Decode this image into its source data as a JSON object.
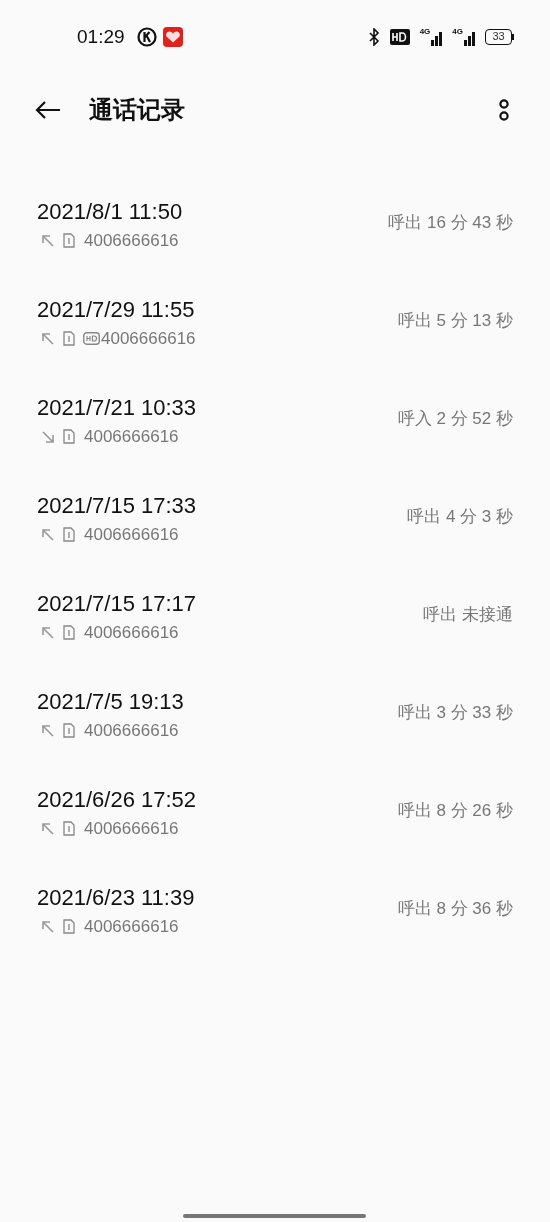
{
  "status_bar": {
    "time": "01:29",
    "network_1": "4G",
    "network_2": "4G",
    "battery": "33"
  },
  "header": {
    "title": "通话记录"
  },
  "calls": [
    {
      "date": "2021/8/1 11:50",
      "kind": "outgoing",
      "hd": false,
      "number": "4006666616",
      "type": "呼出",
      "duration": "16 分 43 秒"
    },
    {
      "date": "2021/7/29 11:55",
      "kind": "outgoing",
      "hd": true,
      "number": "4006666616",
      "type": "呼出",
      "duration": "5 分 13 秒"
    },
    {
      "date": "2021/7/21 10:33",
      "kind": "incoming",
      "hd": false,
      "number": "4006666616",
      "type": "呼入",
      "duration": "2 分 52 秒"
    },
    {
      "date": "2021/7/15 17:33",
      "kind": "outgoing",
      "hd": false,
      "number": "4006666616",
      "type": "呼出",
      "duration": "4 分 3 秒"
    },
    {
      "date": "2021/7/15 17:17",
      "kind": "outgoing",
      "hd": false,
      "number": "4006666616",
      "type": "呼出",
      "duration": "未接通"
    },
    {
      "date": "2021/7/5 19:13",
      "kind": "outgoing",
      "hd": false,
      "number": "4006666616",
      "type": "呼出",
      "duration": "3 分 33 秒"
    },
    {
      "date": "2021/6/26 17:52",
      "kind": "outgoing",
      "hd": false,
      "number": "4006666616",
      "type": "呼出",
      "duration": "8 分 26 秒"
    },
    {
      "date": "2021/6/23 11:39",
      "kind": "outgoing",
      "hd": false,
      "number": "4006666616",
      "type": "呼出",
      "duration": "8 分 36 秒"
    }
  ]
}
